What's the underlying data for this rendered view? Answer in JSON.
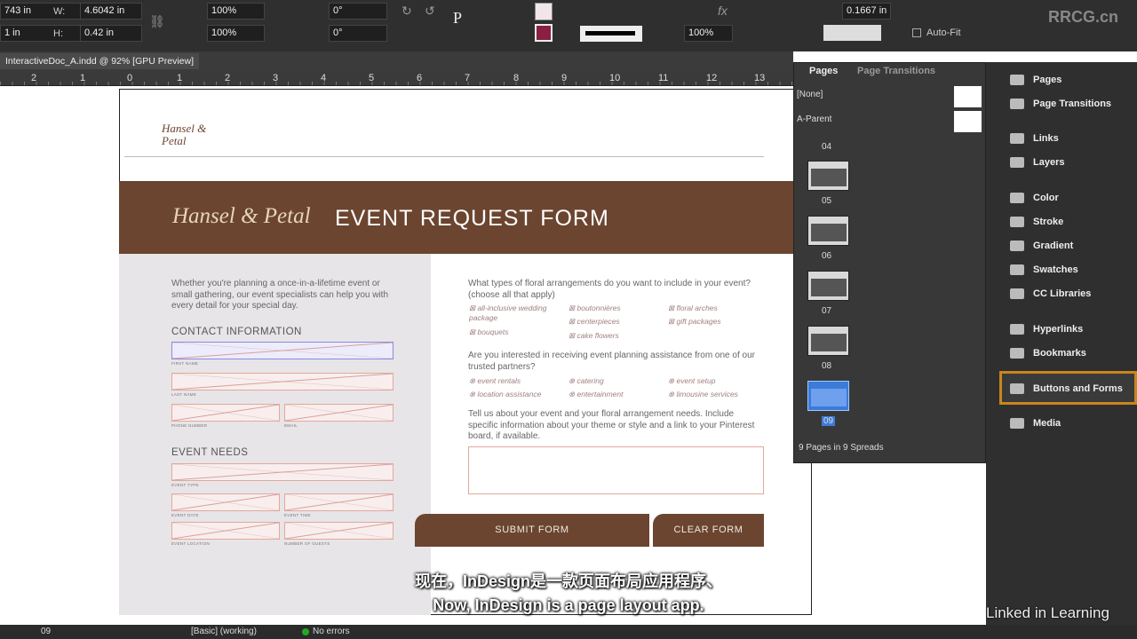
{
  "toolbar": {
    "x_value": "743 in",
    "y_value": "1 in",
    "w_label": "W:",
    "w_value": "4.6042 in",
    "h_label": "H:",
    "h_value": "0.42 in",
    "scale_x": "100%",
    "scale_y": "100%",
    "rotate": "0°",
    "shear": "0°",
    "stroke_percent": "100%",
    "inset": "0.1667 in",
    "autofit_label": "Auto-Fit"
  },
  "document_tab": "InteractiveDoc_A.indd @ 92% [GPU Preview]",
  "ruler": [
    "2",
    "1",
    "0",
    "1",
    "2",
    "3",
    "4",
    "5",
    "6",
    "7",
    "8",
    "9",
    "10",
    "11",
    "12",
    "13"
  ],
  "form": {
    "brand": "Hansel & Petal",
    "title": "EVENT REQUEST FORM",
    "logo_text": "Hansel & Petal",
    "intro": "Whether you're planning a once-in-a-lifetime event or small gathering, our event specialists can help you with every detail for your special day.",
    "contact_heading": "CONTACT INFORMATION",
    "contact_labels": [
      "FIRST NAME",
      "LAST NAME",
      "PHONE NUMBER",
      "EMAIL"
    ],
    "event_heading": "EVENT NEEDS",
    "event_labels": [
      "EVENT TYPE",
      "EVENT DATE",
      "EVENT TIME",
      "EVENT LOCATION",
      "NUMBER OF GUESTS"
    ],
    "q1": "What types of floral arrangements do you want to include in your event? (choose all that apply)",
    "q1_options": [
      "all-inclusive wedding package",
      "boutonnières",
      "floral arches",
      "bouquets",
      "centerpieces",
      "gift packages",
      "cake flowers"
    ],
    "q2": "Are you interested in receiving event planning assistance from one of our trusted partners?",
    "q2_options": [
      "event rentals",
      "catering",
      "event setup",
      "location assistance",
      "entertainment",
      "limousine services"
    ],
    "q3": "Tell us about your event and your floral arrangement needs. Include specific information about your theme or style and a link to your Pinterest board, if available.",
    "submit": "SUBMIT FORM",
    "clear": "CLEAR FORM"
  },
  "pages_panel": {
    "tabs": [
      "Pages",
      "Page Transitions"
    ],
    "parents": [
      "[None]",
      "A-Parent"
    ],
    "pages": [
      "04",
      "05",
      "06",
      "07",
      "08",
      "09"
    ],
    "selected": "09",
    "footer": "9 Pages in 9 Spreads"
  },
  "dock": [
    "Pages",
    "Page Transitions",
    "Links",
    "Layers",
    "Color",
    "Stroke",
    "Gradient",
    "Swatches",
    "CC Libraries",
    "Hyperlinks",
    "Bookmarks",
    "Buttons and Forms",
    "Media"
  ],
  "status": {
    "page": "09",
    "profile": "[Basic] (working)",
    "errors": "No errors"
  },
  "subtitles": {
    "zh": "现在，InDesign是一款页面布局应用程序、",
    "en": "Now, InDesign is a page layout app."
  },
  "watermark": "RRCG.cn",
  "branding": "Linked in Learning",
  "colors": {
    "brown": "#6b4530",
    "highlight": "#c8861e",
    "selected_page": "#3d7bd9"
  }
}
